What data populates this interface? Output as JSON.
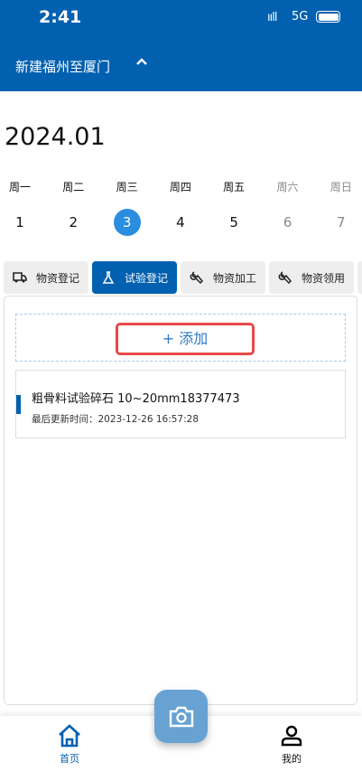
{
  "status": {
    "time": "2:41",
    "signal": "ııll",
    "network": "5G"
  },
  "header": {
    "project": "新建福州至厦门",
    "chevron": "⌃"
  },
  "calendar": {
    "month": "2024.01",
    "weekdays": [
      "周一",
      "周二",
      "周三",
      "周四",
      "周五",
      "周六",
      "周日"
    ],
    "days": [
      "1",
      "2",
      "3",
      "4",
      "5",
      "6",
      "7"
    ],
    "selected_day": "3"
  },
  "tabs": [
    {
      "label": "物资登记",
      "icon": "truck-icon"
    },
    {
      "label": "试验登记",
      "icon": "flask-icon",
      "active": true
    },
    {
      "label": "物资加工",
      "icon": "wrench-icon"
    },
    {
      "label": "物资领用",
      "icon": "wrench-icon"
    },
    {
      "label": "",
      "icon": "document-icon"
    }
  ],
  "main": {
    "add_label": "+ 添加",
    "items": [
      {
        "title": "粗骨料试验碎石 10~20mm18377473",
        "updated": "最后更新时间：2023-12-26 16:57:28"
      }
    ]
  },
  "nav": {
    "home": "首页",
    "mine": "我的"
  },
  "colors": {
    "primary": "#0260b0",
    "highlight": "#e8494a",
    "fab": "#67a2d3"
  }
}
